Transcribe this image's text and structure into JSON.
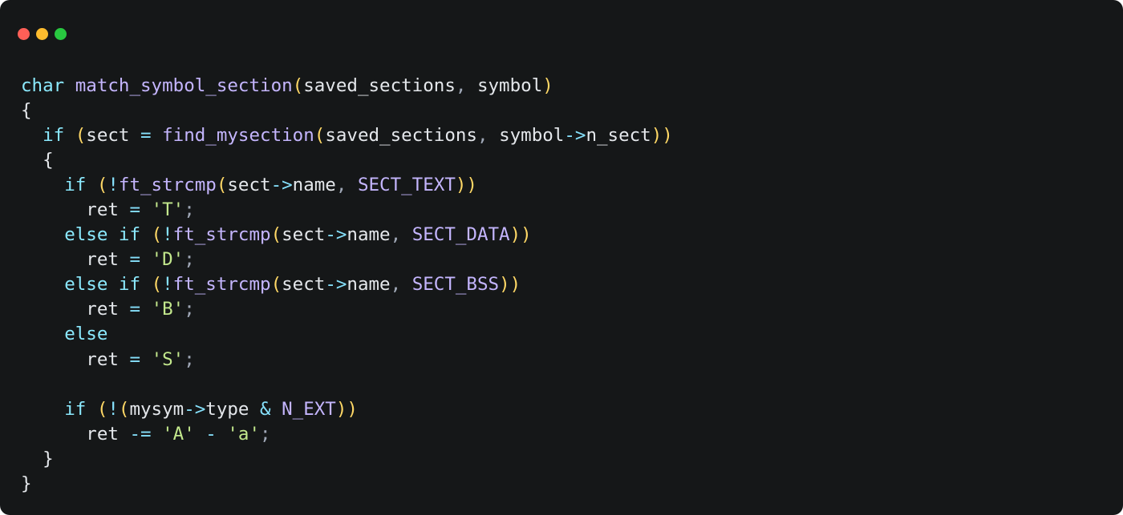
{
  "code": {
    "line1": {
      "type_kw": "char",
      "space": " ",
      "func": "match_symbol_section",
      "lparen": "(",
      "arg1": "saved_sections",
      "comma": ", ",
      "arg2": "symbol",
      "rparen": ")"
    },
    "line2": {
      "brace": "{"
    },
    "line3": {
      "indent": "  ",
      "kw": "if",
      "sp": " ",
      "lparen": "(",
      "lhs": "sect",
      "sp2": " ",
      "eq": "=",
      "sp3": " ",
      "call": "find_mysection",
      "lparen2": "(",
      "a1": "saved_sections",
      "comma": ", ",
      "a2a": "symbol",
      "arrow": "->",
      "a2b": "n_sect",
      "rparen2": ")",
      "rparen": ")"
    },
    "line4": {
      "indent": "  ",
      "brace": "{"
    },
    "line5": {
      "indent": "    ",
      "kw": "if",
      "sp": " ",
      "lparen": "(",
      "bang": "!",
      "call": "ft_strcmp",
      "lparen2": "(",
      "a1a": "sect",
      "arrow": "->",
      "a1b": "name",
      "comma": ", ",
      "const": "SECT_TEXT",
      "rparen2": ")",
      "rparen": ")"
    },
    "line6": {
      "indent": "      ",
      "lhs": "ret",
      "sp": " ",
      "eq": "=",
      "sp2": " ",
      "lit": "'T'",
      "semi": ";"
    },
    "line7": {
      "indent": "    ",
      "kw1": "else",
      "sp": " ",
      "kw2": "if",
      "sp2": " ",
      "lparen": "(",
      "bang": "!",
      "call": "ft_strcmp",
      "lparen2": "(",
      "a1a": "sect",
      "arrow": "->",
      "a1b": "name",
      "comma": ", ",
      "const": "SECT_DATA",
      "rparen2": ")",
      "rparen": ")"
    },
    "line8": {
      "indent": "      ",
      "lhs": "ret",
      "sp": " ",
      "eq": "=",
      "sp2": " ",
      "lit": "'D'",
      "semi": ";"
    },
    "line9": {
      "indent": "    ",
      "kw1": "else",
      "sp": " ",
      "kw2": "if",
      "sp2": " ",
      "lparen": "(",
      "bang": "!",
      "call": "ft_strcmp",
      "lparen2": "(",
      "a1a": "sect",
      "arrow": "->",
      "a1b": "name",
      "comma": ", ",
      "const": "SECT_BSS",
      "rparen2": ")",
      "rparen": ")"
    },
    "line10": {
      "indent": "      ",
      "lhs": "ret",
      "sp": " ",
      "eq": "=",
      "sp2": " ",
      "lit": "'B'",
      "semi": ";"
    },
    "line11": {
      "indent": "    ",
      "kw": "else"
    },
    "line12": {
      "indent": "      ",
      "lhs": "ret",
      "sp": " ",
      "eq": "=",
      "sp2": " ",
      "lit": "'S'",
      "semi": ";"
    },
    "line13": {
      "blank": ""
    },
    "line14": {
      "indent": "    ",
      "kw": "if",
      "sp": " ",
      "lparen": "(",
      "bang": "!",
      "lparen2": "(",
      "a1a": "mysym",
      "arrow": "->",
      "a1b": "type",
      "sp2": " ",
      "amp": "&",
      "sp3": " ",
      "const": "N_EXT",
      "rparen2": ")",
      "rparen": ")"
    },
    "line15": {
      "indent": "      ",
      "lhs": "ret",
      "sp": " ",
      "op": "-=",
      "sp2": " ",
      "lit1": "'A'",
      "sp3": " ",
      "minus": "-",
      "sp4": " ",
      "lit2": "'a'",
      "semi": ";"
    },
    "line16": {
      "indent": "  ",
      "brace": "}"
    },
    "line17": {
      "brace": "}"
    }
  }
}
